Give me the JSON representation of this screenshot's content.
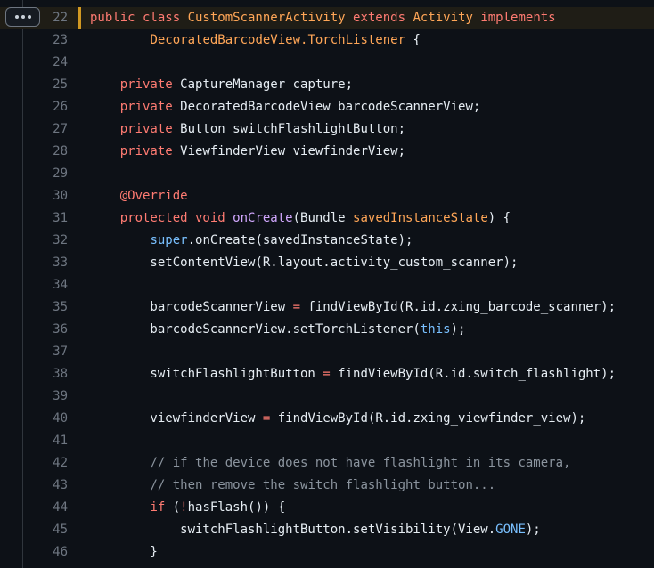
{
  "expand_button": {
    "label": "..."
  },
  "code_lines": [
    {
      "num": "22",
      "highlighted": true,
      "tokens": [
        {
          "t": "public class ",
          "c": "kw"
        },
        {
          "t": "CustomScannerActivity",
          "c": "cls"
        },
        {
          "t": " extends ",
          "c": "kw"
        },
        {
          "t": "Activity",
          "c": "cls"
        },
        {
          "t": " implements",
          "c": "kw"
        }
      ]
    },
    {
      "num": "23",
      "tokens": [
        {
          "t": "        "
        },
        {
          "t": "DecoratedBarcodeView.TorchListener",
          "c": "cls"
        },
        {
          "t": " {"
        }
      ]
    },
    {
      "num": "24",
      "tokens": []
    },
    {
      "num": "25",
      "tokens": [
        {
          "t": "    "
        },
        {
          "t": "private",
          "c": "kw"
        },
        {
          "t": " CaptureManager capture;"
        }
      ]
    },
    {
      "num": "26",
      "tokens": [
        {
          "t": "    "
        },
        {
          "t": "private",
          "c": "kw"
        },
        {
          "t": " DecoratedBarcodeView barcodeScannerView;"
        }
      ]
    },
    {
      "num": "27",
      "tokens": [
        {
          "t": "    "
        },
        {
          "t": "private",
          "c": "kw"
        },
        {
          "t": " Button switchFlashlightButton;"
        }
      ]
    },
    {
      "num": "28",
      "tokens": [
        {
          "t": "    "
        },
        {
          "t": "private",
          "c": "kw"
        },
        {
          "t": " ViewfinderView viewfinderView;"
        }
      ]
    },
    {
      "num": "29",
      "tokens": []
    },
    {
      "num": "30",
      "tokens": [
        {
          "t": "    "
        },
        {
          "t": "@Override",
          "c": "kw"
        }
      ]
    },
    {
      "num": "31",
      "tokens": [
        {
          "t": "    "
        },
        {
          "t": "protected void ",
          "c": "kw"
        },
        {
          "t": "onCreate",
          "c": "fn"
        },
        {
          "t": "(Bundle "
        },
        {
          "t": "savedInstanceState",
          "c": "cls"
        },
        {
          "t": ") {"
        }
      ]
    },
    {
      "num": "32",
      "tokens": [
        {
          "t": "        "
        },
        {
          "t": "super",
          "c": "bl"
        },
        {
          "t": ".onCreate(savedInstanceState);"
        }
      ]
    },
    {
      "num": "33",
      "tokens": [
        {
          "t": "        setContentView(R.layout.activity_custom_scanner);"
        }
      ]
    },
    {
      "num": "34",
      "tokens": []
    },
    {
      "num": "35",
      "tokens": [
        {
          "t": "        barcodeScannerView "
        },
        {
          "t": "=",
          "c": "op"
        },
        {
          "t": " findViewById(R.id.zxing_barcode_scanner);"
        }
      ]
    },
    {
      "num": "36",
      "tokens": [
        {
          "t": "        barcodeScannerView.setTorchListener("
        },
        {
          "t": "this",
          "c": "bl"
        },
        {
          "t": ");"
        }
      ]
    },
    {
      "num": "37",
      "tokens": []
    },
    {
      "num": "38",
      "tokens": [
        {
          "t": "        switchFlashlightButton "
        },
        {
          "t": "=",
          "c": "op"
        },
        {
          "t": " findViewById(R.id.switch_flashlight);"
        }
      ]
    },
    {
      "num": "39",
      "tokens": []
    },
    {
      "num": "40",
      "tokens": [
        {
          "t": "        viewfinderView "
        },
        {
          "t": "=",
          "c": "op"
        },
        {
          "t": " findViewById(R.id.zxing_viewfinder_view);"
        }
      ]
    },
    {
      "num": "41",
      "tokens": []
    },
    {
      "num": "42",
      "tokens": [
        {
          "t": "        "
        },
        {
          "t": "// if the device does not have flashlight in its camera,",
          "c": "cm"
        }
      ]
    },
    {
      "num": "43",
      "tokens": [
        {
          "t": "        "
        },
        {
          "t": "// then remove the switch flashlight button...",
          "c": "cm"
        }
      ]
    },
    {
      "num": "44",
      "tokens": [
        {
          "t": "        "
        },
        {
          "t": "if",
          "c": "kw"
        },
        {
          "t": " ("
        },
        {
          "t": "!",
          "c": "op"
        },
        {
          "t": "hasFlash()) {"
        }
      ]
    },
    {
      "num": "45",
      "tokens": [
        {
          "t": "            switchFlashlightButton.setVisibility(View."
        },
        {
          "t": "GONE",
          "c": "bl"
        },
        {
          "t": ");"
        }
      ]
    },
    {
      "num": "46",
      "tokens": [
        {
          "t": "        }"
        }
      ]
    }
  ]
}
